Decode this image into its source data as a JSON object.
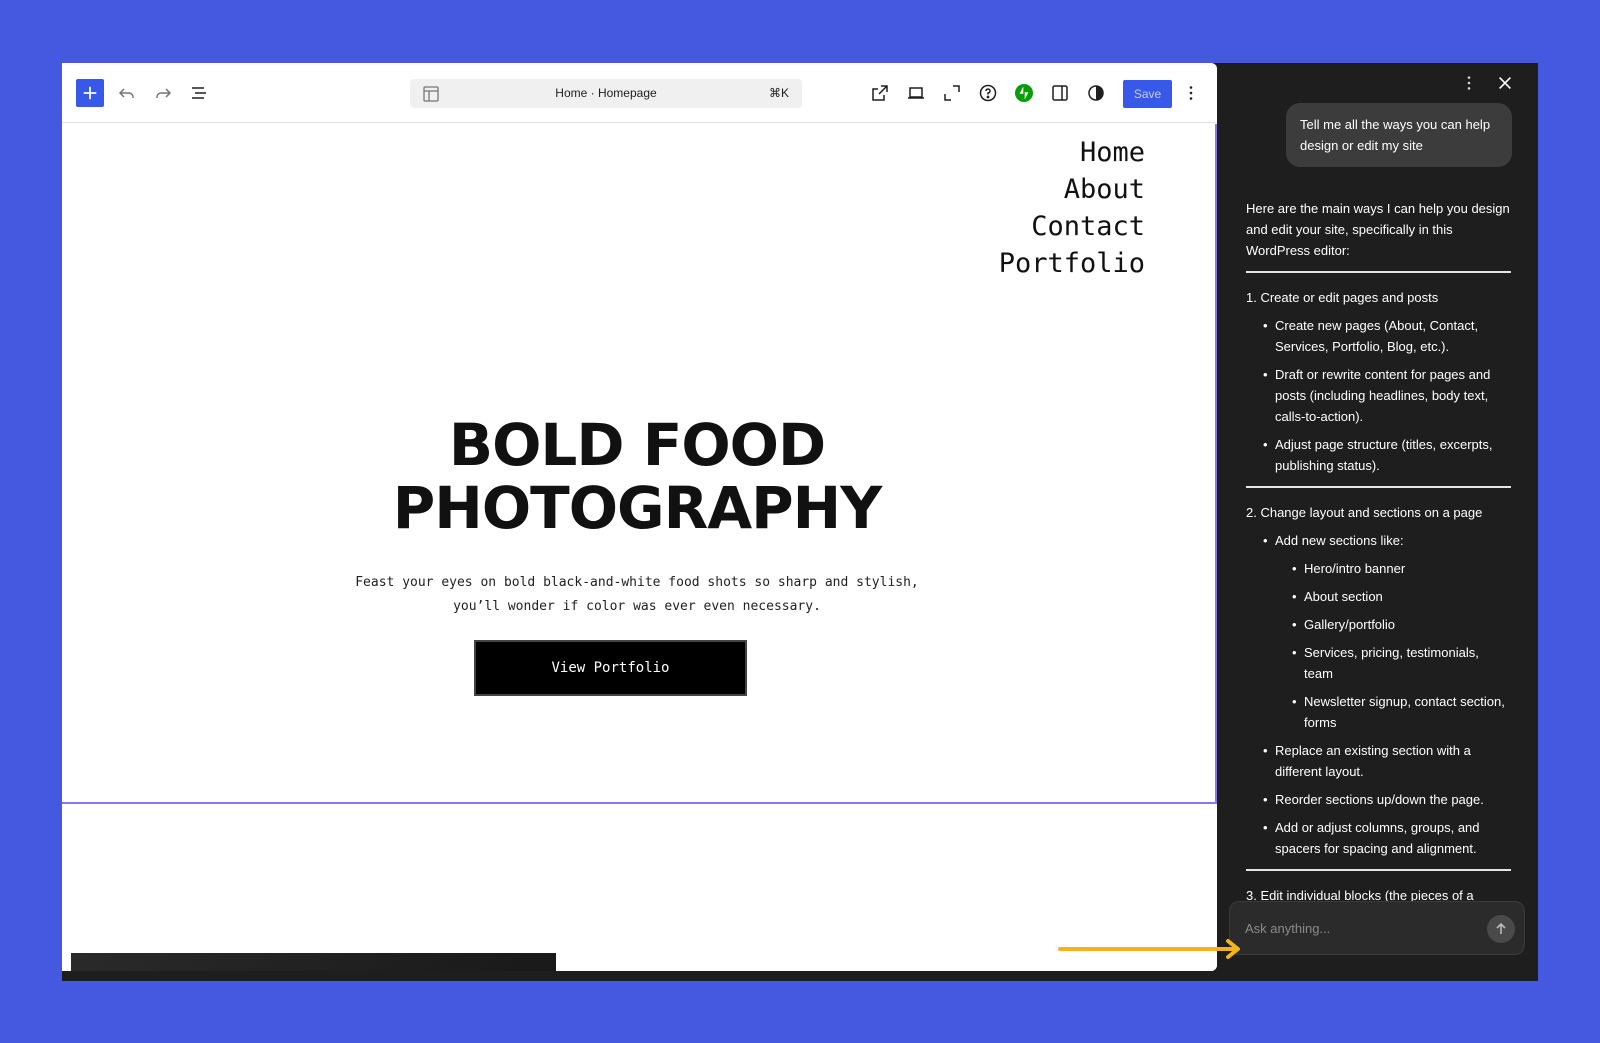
{
  "toolbar": {
    "document_title": "Home · Homepage",
    "shortcut": "⌘K",
    "save_label": "Save",
    "icons": [
      "plus-icon",
      "undo-icon",
      "redo-icon",
      "list-view-icon",
      "template-icon",
      "external-link-icon",
      "desktop-icon",
      "fullscreen-icon",
      "help-icon",
      "jetpack-icon",
      "sidebar-icon",
      "styles-icon",
      "more-vertical-icon"
    ]
  },
  "page": {
    "nav_items": [
      "Home",
      "About",
      "Contact",
      "Portfolio"
    ],
    "hero_title_line1": "BOLD FOOD",
    "hero_title_line2": "PHOTOGRAPHY",
    "hero_desc": "Feast your eyes on bold black-and-white food shots so sharp and stylish,\nyou’ll wonder if color was ever even necessary.",
    "cta_label": "View Portfolio"
  },
  "assistant": {
    "user_message": "Tell me all the ways you can help design or edit my site",
    "intro": "Here are the main ways I can help you design and edit your site, specifically in this WordPress editor:",
    "sections": [
      {
        "heading": "1. Create or edit pages and posts",
        "items": [
          "Create new pages (About, Contact, Services, Portfolio, Blog, etc.).",
          "Draft or rewrite content for pages and posts (including headlines, body text, calls-to-action).",
          "Adjust page structure (titles, excerpts, publishing status)."
        ]
      },
      {
        "heading": "2. Change layout and sections on a page",
        "lead": "Add new sections like:",
        "sub_items": [
          "Hero/intro banner",
          "About section",
          "Gallery/portfolio",
          "Services, pricing, testimonials, team",
          "Newsletter signup, contact section, forms"
        ],
        "items": [
          "Replace an existing section with a different layout.",
          "Reorder sections up/down the page.",
          "Add or adjust columns, groups, and spacers for spacing and alignment."
        ]
      },
      {
        "heading": "3. Edit individual blocks (the pieces of a"
      }
    ],
    "input_placeholder": "Ask anything...",
    "accent_arrow_color": "#f3b31c"
  }
}
